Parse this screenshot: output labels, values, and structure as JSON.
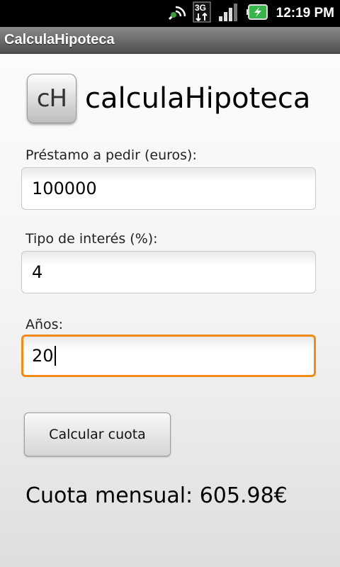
{
  "status_bar": {
    "time": "12:19 PM",
    "icons": [
      "sync-icon",
      "3g-icon",
      "signal-icon",
      "battery-charging-icon"
    ],
    "network_label": "3G"
  },
  "title_bar": {
    "title": "CalculaHipoteca"
  },
  "header": {
    "logo_text": "cH",
    "app_name": "calculaHipoteca"
  },
  "form": {
    "loan_label": "Préstamo a pedir (euros):",
    "loan_value": "100000",
    "rate_label": "Tipo de interés (%):",
    "rate_value": "4",
    "years_label": "Años:",
    "years_value": "20"
  },
  "actions": {
    "calculate_label": "Calcular cuota"
  },
  "result": {
    "text": "Cuota mensual: 605.98€"
  },
  "colors": {
    "focus": "#f08a18",
    "battery_green": "#37b34a"
  }
}
